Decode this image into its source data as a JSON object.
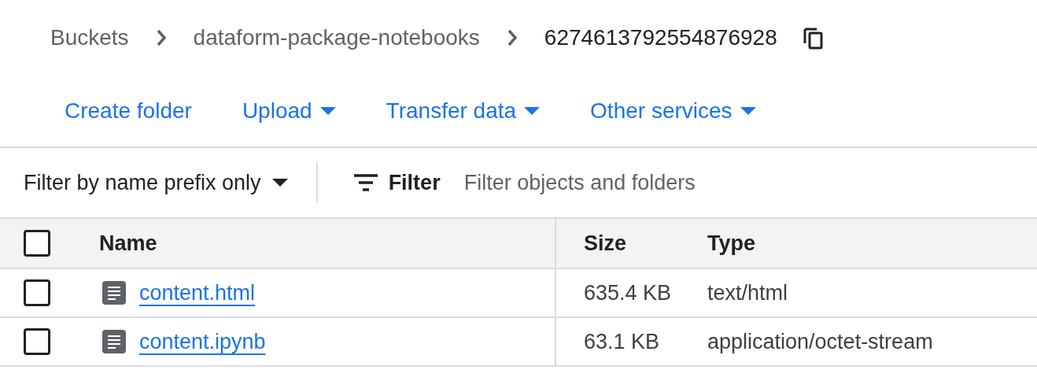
{
  "breadcrumb": [
    {
      "label": "Buckets",
      "current": false
    },
    {
      "label": "dataform-package-notebooks",
      "current": false
    },
    {
      "label": "6274613792554876928",
      "current": true
    }
  ],
  "actions": [
    {
      "label": "Create folder",
      "dropdown": false
    },
    {
      "label": "Upload",
      "dropdown": true
    },
    {
      "label": "Transfer data",
      "dropdown": true
    },
    {
      "label": "Other services",
      "dropdown": true
    }
  ],
  "filter_bar": {
    "mode": "Filter by name prefix only",
    "filter_label": "Filter",
    "placeholder": "Filter objects and folders"
  },
  "table": {
    "select_all": {
      "checked": false
    },
    "columns": [
      "Name",
      "Size",
      "Type"
    ],
    "rows": [
      {
        "checked": false,
        "name": "content.html",
        "size": "635.4 KB",
        "type": "text/html"
      },
      {
        "checked": false,
        "name": "content.ipynb",
        "size": "63.1 KB",
        "type": "application/octet-stream"
      }
    ]
  }
}
